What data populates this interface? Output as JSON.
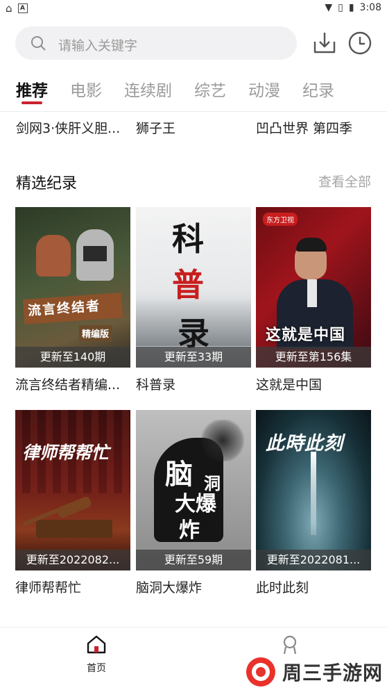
{
  "status_bar": {
    "time": "3:08"
  },
  "search": {
    "placeholder": "请输入关键字"
  },
  "tabs": [
    {
      "label": "推荐"
    },
    {
      "label": "电影"
    },
    {
      "label": "连续剧"
    },
    {
      "label": "综艺"
    },
    {
      "label": "动漫"
    },
    {
      "label": "纪录"
    }
  ],
  "prev_row": [
    "剑网3·侠肝义胆...",
    "狮子王",
    "凹凸世界 第四季"
  ],
  "section": {
    "title": "精选纪录",
    "view_all": "查看全部"
  },
  "cards": [
    {
      "title": "流言终结者精编...",
      "badge": "更新至140期",
      "poster_lines": [
        "流言终结者",
        "精编版"
      ]
    },
    {
      "title": "科普录",
      "badge": "更新至33期",
      "poster_lines": [
        "科",
        "普",
        "录"
      ]
    },
    {
      "title": "这就是中国",
      "badge": "更新至第156集",
      "poster_lines": [
        "这就是中国",
        "东方卫视"
      ]
    },
    {
      "title": "律师帮帮忙",
      "badge": "更新至2022082...",
      "poster_lines": [
        "律师帮帮忙"
      ]
    },
    {
      "title": "脑洞大爆炸",
      "badge": "更新至59期",
      "poster_lines": [
        "脑",
        "洞",
        "大爆",
        "炸"
      ]
    },
    {
      "title": "此时此刻",
      "badge": "更新至2022081...",
      "poster_lines": [
        "此時此刻"
      ]
    }
  ],
  "bottom_nav": {
    "home": "首页"
  },
  "watermark": {
    "text": "周三手游网"
  },
  "colors": {
    "accent": "#c8222f"
  }
}
